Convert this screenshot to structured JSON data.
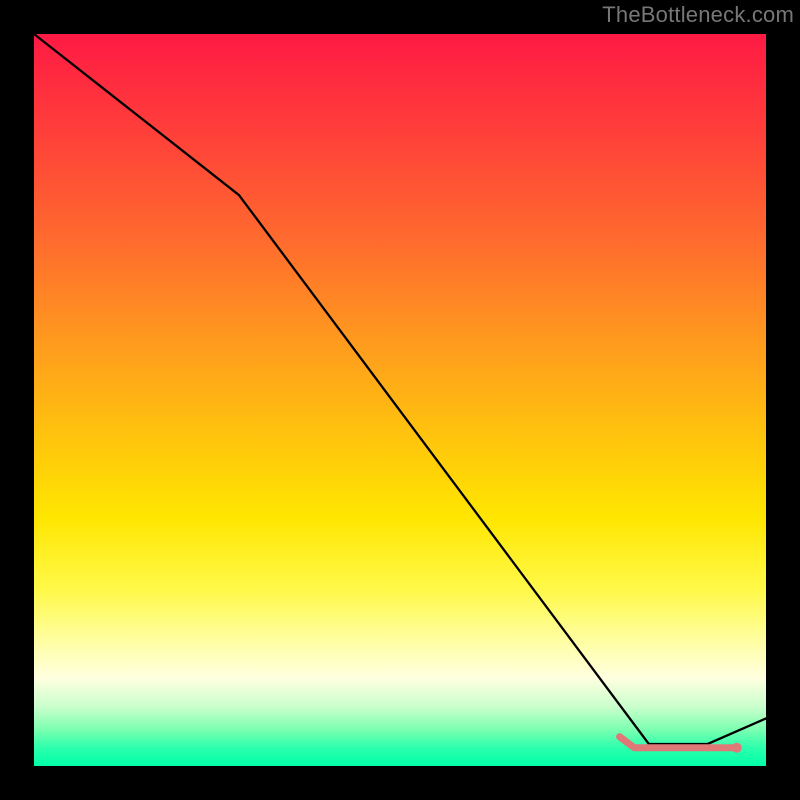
{
  "attribution": "TheBottleneck.com",
  "colors": {
    "background": "#000000",
    "attribution": "#777777",
    "curve": "#000000",
    "marker": "#e07878",
    "gradient_top": "#ff1a44",
    "gradient_bottom": "#00ffa8"
  },
  "chart_data": {
    "type": "line",
    "title": "",
    "xlabel": "",
    "ylabel": "",
    "xlim": [
      0,
      100
    ],
    "ylim": [
      0,
      100
    ],
    "series": [
      {
        "name": "curve",
        "x": [
          0,
          28,
          84,
          92,
          100
        ],
        "values": [
          100,
          78,
          3,
          3,
          6.5
        ]
      }
    ],
    "marker": {
      "name": "optimal-range",
      "x_range": [
        80,
        96
      ],
      "y": 2.5,
      "points": [
        {
          "x": 80,
          "y": 4
        },
        {
          "x": 82,
          "y": 2.5
        },
        {
          "x": 96,
          "y": 2.5
        }
      ]
    }
  }
}
